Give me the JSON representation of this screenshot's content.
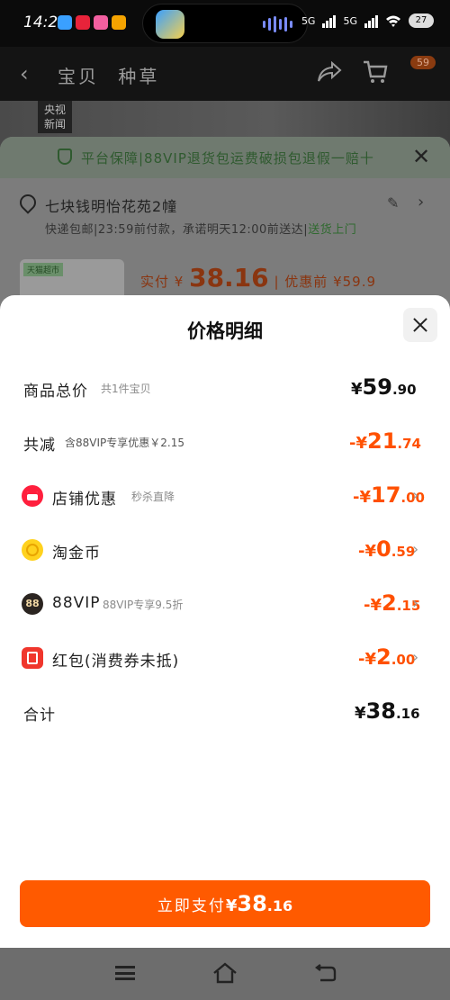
{
  "status_bar": {
    "time": "14:21",
    "app_icon_colors": [
      "#3aa0ff",
      "#e8233a",
      "#f25fa0",
      "#f4a300"
    ],
    "network_1": "5G",
    "network_2": "5G",
    "battery": "27"
  },
  "background_app": {
    "back": "‹",
    "tabs": [
      "宝贝",
      "种草"
    ],
    "cart_badge": "59",
    "hero_logo_line1": "央视",
    "hero_logo_line2": "新闻",
    "guarantee_text": "平台保障|88VIP退货包运费破损包退假一赔十",
    "address_name": "七块钱明怡花苑2幢",
    "delivery_text": "快递包邮|23:59前付款，承诺明天12:00前送达|",
    "delivery_link": "送货上门",
    "product_tag": "天猫超市",
    "actual_pay_label": "实付 ¥",
    "actual_pay_value": "38.16",
    "before_discount_label": "| 优惠前",
    "before_discount_value": "¥59.9"
  },
  "sheet": {
    "title": "价格明细",
    "rows": [
      {
        "label": "商品总价",
        "sub": "共1件宝贝",
        "cur": "¥",
        "big": "59",
        "dec": ".90"
      },
      {
        "label": "共减",
        "sub": "含88VIP专享优惠￥2.15",
        "cur": "-¥",
        "big": "21",
        "dec": ".74"
      },
      {
        "label": "店铺优惠",
        "sub": "秒杀直降",
        "cur": "-¥",
        "big": "17",
        "dec": ".00"
      },
      {
        "label": "淘金币",
        "sub": "",
        "cur": "-¥",
        "big": "0",
        "dec": ".59"
      },
      {
        "label": "88VIP",
        "sub": "88VIP专享9.5折",
        "cur": "-¥",
        "big": "2",
        "dec": ".15",
        "icon_text": "88"
      },
      {
        "label": "红包(消费券未抵)",
        "sub": "",
        "cur": "-¥",
        "big": "2",
        "dec": ".00"
      },
      {
        "label": "合计",
        "sub": "",
        "cur": "¥",
        "big": "38",
        "dec": ".16"
      }
    ],
    "pay_button": {
      "label": "立即支付",
      "cur": "¥",
      "big": "38",
      "dec": ".16"
    }
  },
  "icons": {
    "shop_coupon": "shop-coupon-icon",
    "taojinbi": "gold-coin-icon",
    "vip": "vip-88-icon",
    "red_packet": "red-packet-icon"
  },
  "colors": {
    "accent_orange": "#ff5000",
    "pay_button": "#ff5a00",
    "guarantee_green": "#2f5a2f"
  }
}
